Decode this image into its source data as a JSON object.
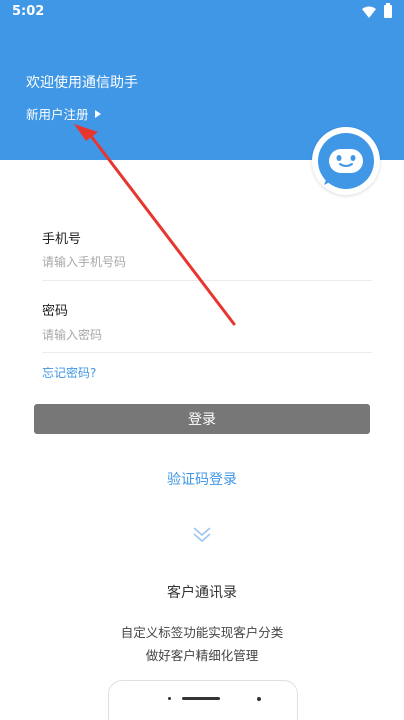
{
  "status_bar": {
    "time": "5:02"
  },
  "header": {
    "welcome": "欢迎使用通信助手",
    "register_link": "新用户注册",
    "background_color": "#3f97e6"
  },
  "form": {
    "phone_label": "手机号",
    "phone_placeholder": "请输入手机号码",
    "password_label": "密码",
    "password_placeholder": "请输入密码",
    "forgot_password": "忘记密码?",
    "login_button": "登录"
  },
  "alt_login": {
    "sms_login": "验证码登录"
  },
  "feature": {
    "title": "客户通讯录",
    "line1": "自定义标签功能实现客户分类",
    "line2": "做好客户精细化管理"
  },
  "colors": {
    "accent": "#3f97e6",
    "button": "#777777",
    "annotation_arrow": "#e8362f"
  },
  "icons": [
    "wifi-icon",
    "battery-icon",
    "triangle-right-icon",
    "robot-avatar-icon",
    "double-chevron-down-icon"
  ]
}
